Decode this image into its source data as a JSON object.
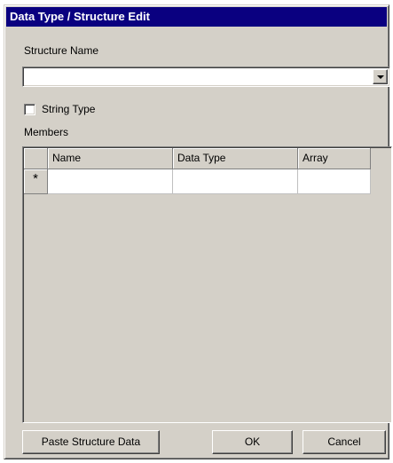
{
  "dialog": {
    "title": "Data Type / Structure Edit"
  },
  "structure_name": {
    "label": "Structure Name",
    "value": ""
  },
  "string_type": {
    "label": "String Type",
    "checked": false
  },
  "members": {
    "label": "Members",
    "columns": [
      "Name",
      "Data Type",
      "Array"
    ],
    "new_row_marker": "*",
    "rows": [
      {
        "name": "",
        "data_type": "",
        "array": ""
      }
    ]
  },
  "buttons": {
    "paste": "Paste Structure Data",
    "ok": "OK",
    "cancel": "Cancel"
  },
  "colors": {
    "titlebar": "#0a0080",
    "face": "#d4d0c8"
  },
  "icons": {
    "dropdown": "chevron-down-icon",
    "new_row": "asterisk-icon"
  }
}
